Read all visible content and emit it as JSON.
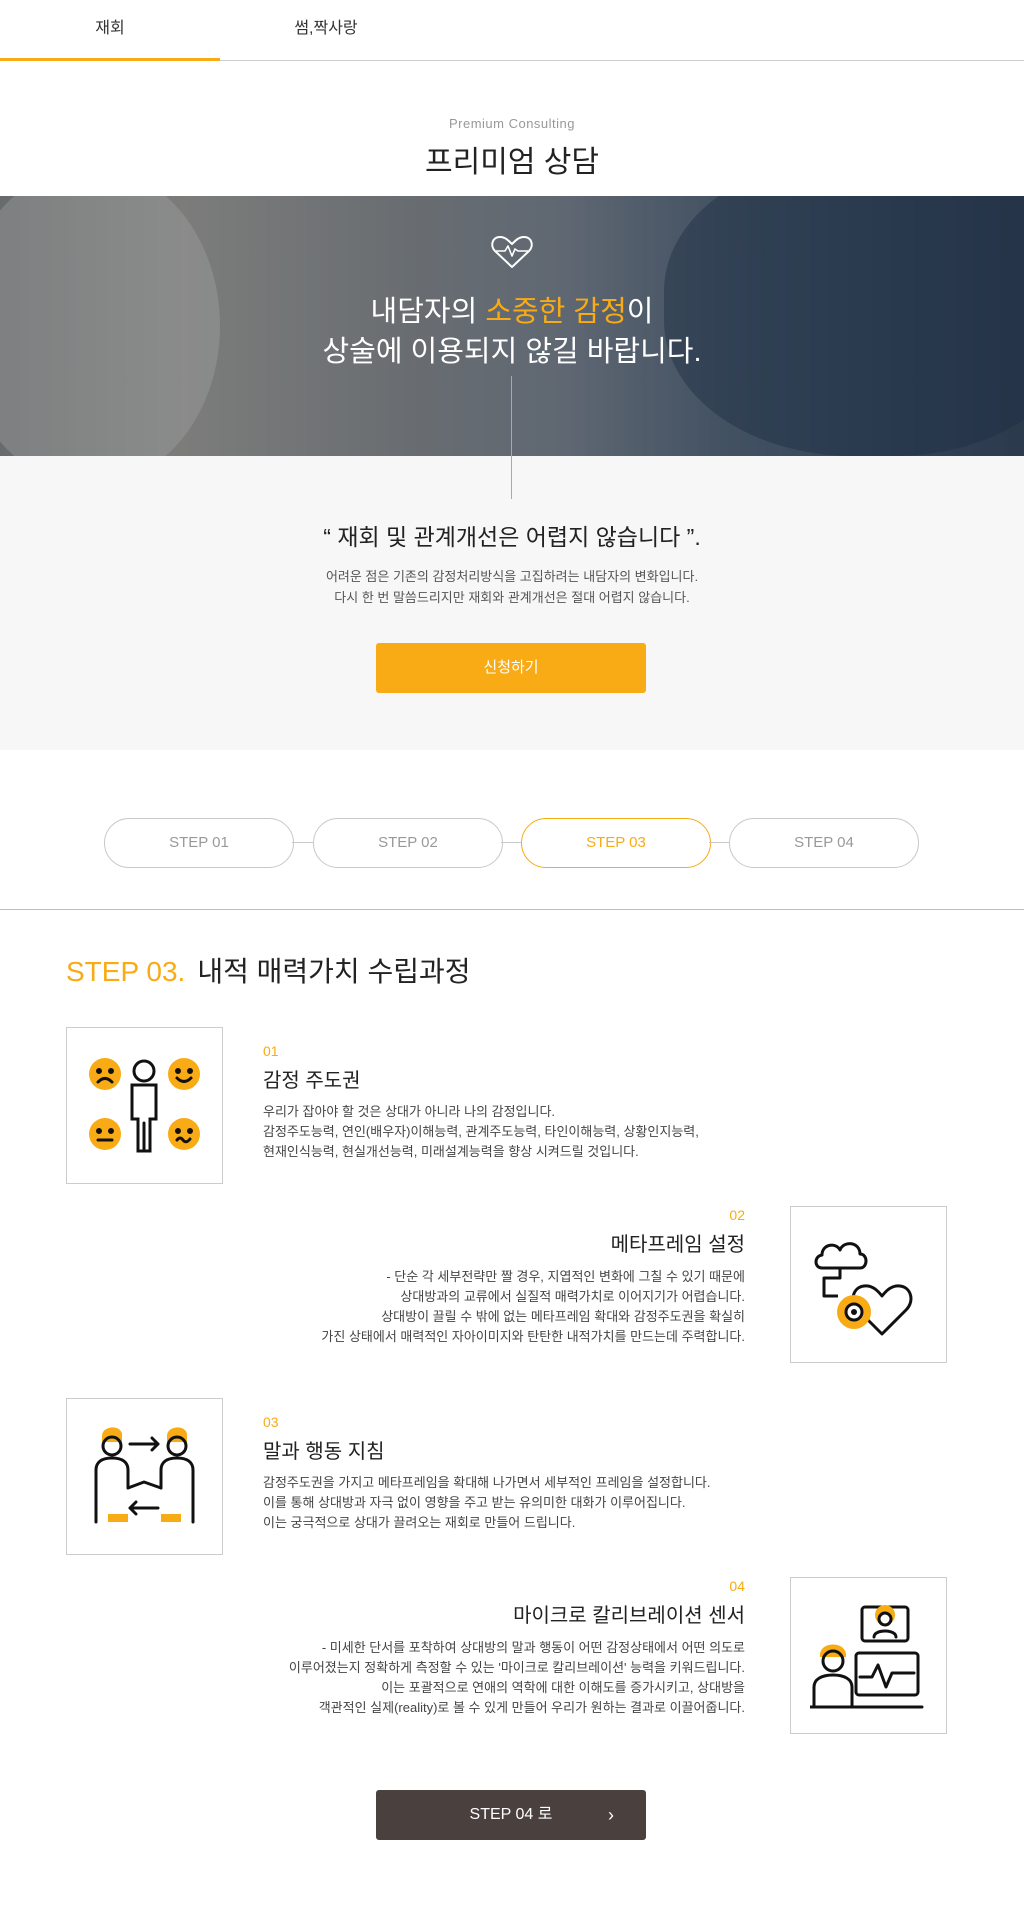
{
  "tabs": [
    {
      "label": "재회",
      "active": true
    },
    {
      "label": "썸,짝사랑",
      "active": false
    }
  ],
  "header": {
    "subtitle_en": "Premium Consulting",
    "title": "프리미엄 상담"
  },
  "hero": {
    "line1_pre": "내담자의 ",
    "line1_accent": "소중한 감정",
    "line1_post": "이",
    "line2": "상술에 이용되지 않길 바랍니다.",
    "icon": "heart-pulse-icon"
  },
  "intro": {
    "quote": "“ 재회 및 관계개선은 어렵지 않습니다 ”.",
    "desc1": "어려운 점은 기존의 감정처리방식을 고집하려는 내담자의 변화입니다.",
    "desc2": "다시 한 번 말씀드리지만 재회와 관계개선은 절대 어렵지 않습니다.",
    "apply_label": "신청하기"
  },
  "steps_nav": [
    {
      "label": "STEP 01",
      "active": false
    },
    {
      "label": "STEP 02",
      "active": false
    },
    {
      "label": "STEP 03",
      "active": true
    },
    {
      "label": "STEP 04",
      "active": false
    }
  ],
  "step": {
    "number": "STEP 03.",
    "title": "내적 매력가치 수립과정"
  },
  "items": [
    {
      "num": "01",
      "title": "감정 주도권",
      "icon": "emotions-person-icon",
      "lines": [
        "우리가 잡아야 할 것은 상대가 아니라 나의 감정입니다.",
        "감정주도능력, 연인(배우자)이해능력, 관계주도능력, 타인이해능력, 상황인지능력,",
        "현재인식능력, 현실개선능력, 미래설계능력을 향상 시켜드릴 것입니다."
      ]
    },
    {
      "num": "02",
      "title": "메타프레임 설정",
      "icon": "cloud-gear-heart-icon",
      "lines": [
        "- 단순 각 세부전략만 짤 경우, 지엽적인 변화에 그칠 수 있기 때문에",
        "상대방과의 교류에서 실질적 매력가치로 이어지기가 어렵습니다.",
        "상대방이 끌릴 수 밖에 없는 메타프레임 확대와 감정주도권을 확실히",
        "가진 상태에서 매력적인 자아이미지와 탄탄한 내적가치를 만드는데 주력합니다."
      ]
    },
    {
      "num": "03",
      "title": "말과 행동 지침",
      "icon": "handshake-exchange-icon",
      "lines": [
        "감정주도권을 가지고 메타프레임을 확대해 나가면서 세부적인 프레임을 설정합니다.",
        "이를 통해 상대방과 자극 없이 영향을 주고 받는 유의미한 대화가 이루어집니다.",
        "이는 궁극적으로 상대가 끌려오는 재회로 만들어 드립니다."
      ]
    },
    {
      "num": "04",
      "title": "마이크로 칼리브레이션 센서",
      "icon": "monitoring-person-icon",
      "lines": [
        "- 미세한 단서를 포착하여 상대방의 말과 행동이 어떤 감정상태에서 어떤 의도로",
        "이루어졌는지 정확하게 측정할 수 있는 '마이크로 칼리브레이션' 능력을 키워드립니다.",
        "이는 포괄적으로 연애의 역학에 대한 이해도를 증가시키고, 상대방을",
        "객관적인 실제(reality)로 볼 수 있게 만들어 우리가 원하는 결과로 이끌어줍니다."
      ]
    }
  ],
  "next": {
    "label": "STEP 04 로",
    "arrow": "›"
  },
  "colors": {
    "accent": "#f8ab14",
    "dark_button": "#4a403d"
  }
}
